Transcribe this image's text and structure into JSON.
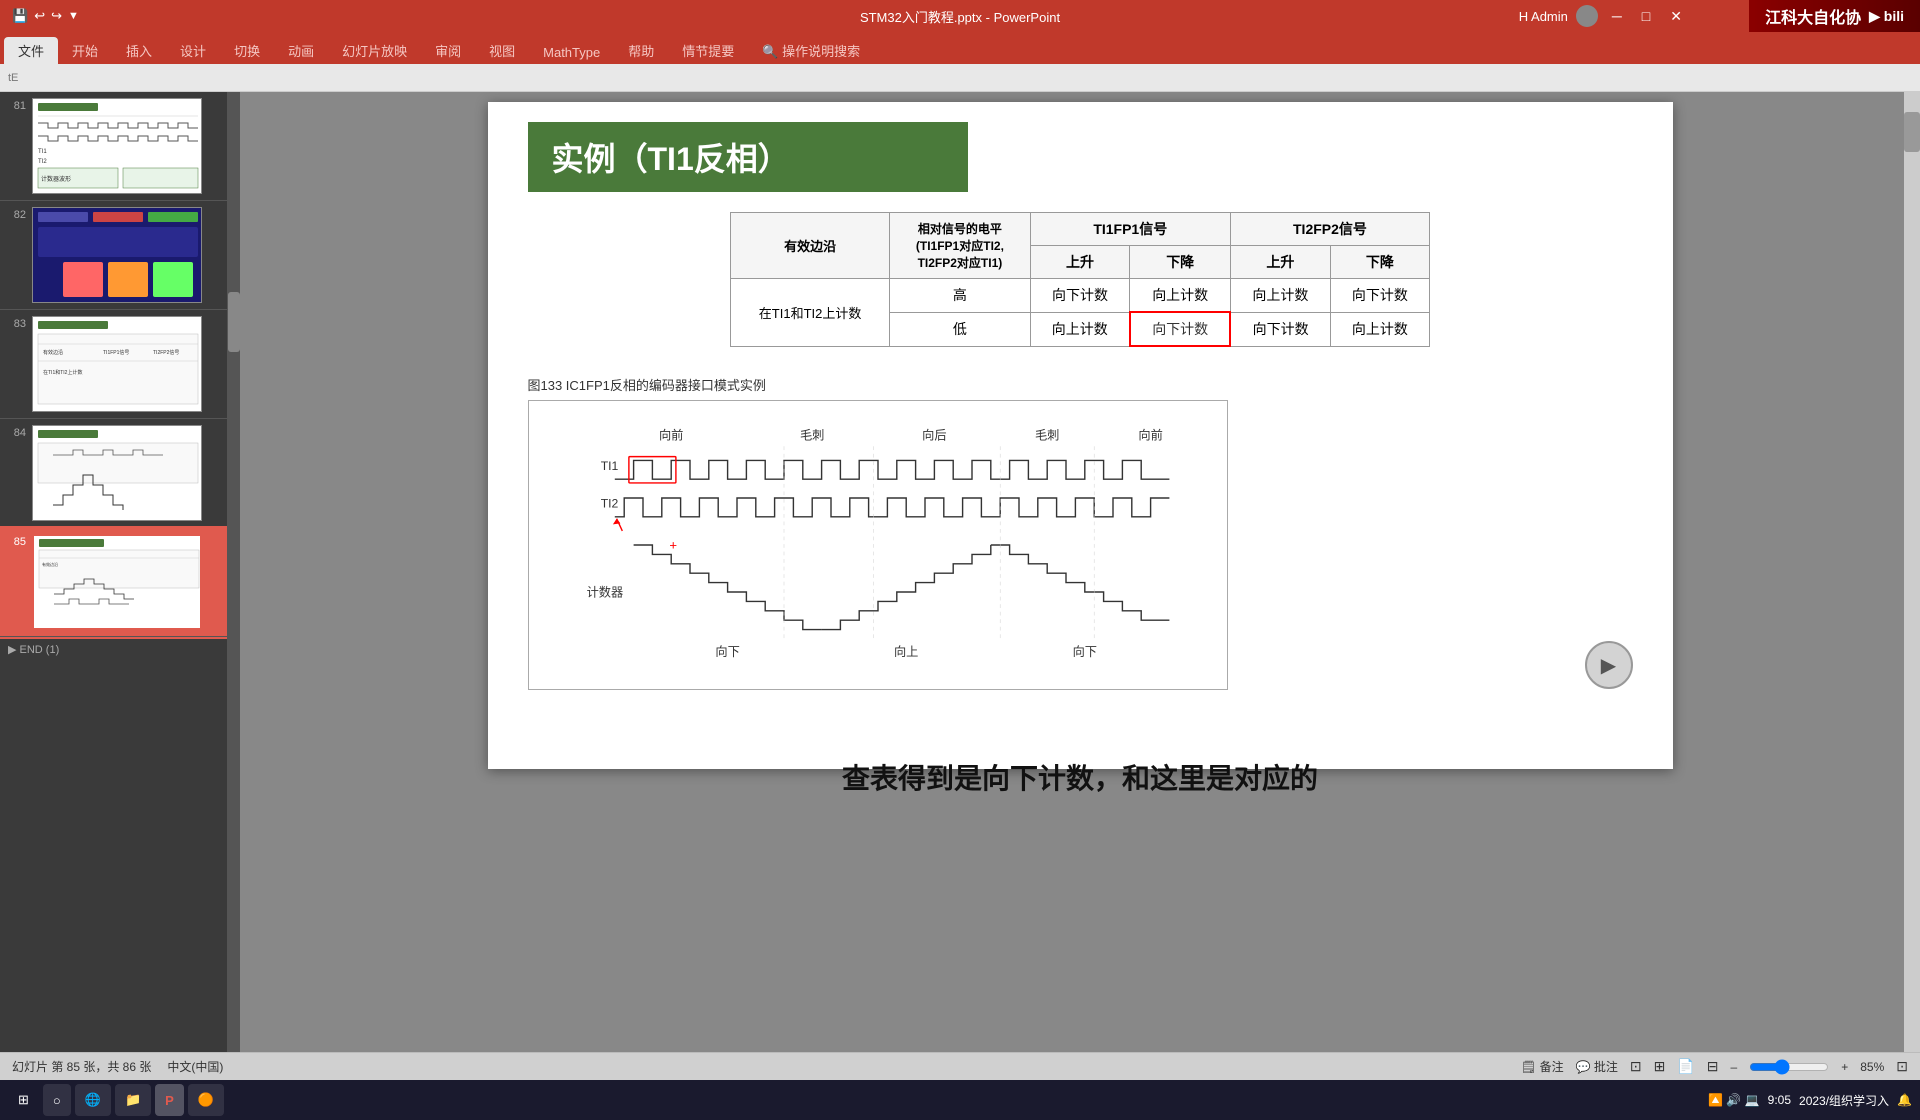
{
  "titlebar": {
    "title": "STM32入门教程.pptx - PowerPoint",
    "user": "H Admin",
    "save_icon": "💾",
    "undo_icon": "↩",
    "redo_icon": "↪"
  },
  "ribbon": {
    "tabs": [
      "文件",
      "开始",
      "插入",
      "设计",
      "切换",
      "动画",
      "幻灯片放映",
      "审阅",
      "视图",
      "MathType",
      "帮助",
      "情节提要",
      "操作说明搜索"
    ]
  },
  "sidebar": {
    "slides": [
      {
        "num": "81",
        "label": "slide-81"
      },
      {
        "num": "82",
        "label": "slide-82"
      },
      {
        "num": "83",
        "label": "slide-83"
      },
      {
        "num": "84",
        "label": "slide-84"
      },
      {
        "num": "85",
        "label": "slide-85",
        "active": true
      }
    ]
  },
  "slide": {
    "title": "实例（TI1反相）",
    "table": {
      "headers": {
        "col1": "有效边沿",
        "col2_header": "相对信号的电平\n(TI1FP1对应TI2,\nTI2FP2对应TI1)",
        "col3_header": "TI1FP1信号",
        "col4_header": "TI2FP2信号",
        "col3_sub1": "上升",
        "col3_sub2": "下降",
        "col4_sub1": "上升",
        "col4_sub2": "下降"
      },
      "rows": [
        {
          "row_header": "在TI1和TI2上计数",
          "level": "高",
          "c1": "向下计数",
          "c2": "向上计数",
          "c3": "向上计数",
          "c4": "向下计数",
          "highlight": ""
        },
        {
          "level": "低",
          "c1": "向上计数",
          "c2": "向下计数",
          "c3": "向下计数",
          "c4": "向上计数",
          "highlight": "c2"
        }
      ]
    },
    "figure_title": "图133    IC1FP1反相的编码器接口模式实例",
    "labels": {
      "ti1": "TI1",
      "ti2": "TI2",
      "counter": "计数器",
      "forward1": "向前",
      "burr1": "毛刺",
      "backward": "向后",
      "burr2": "毛刺",
      "forward2": "向前",
      "down1": "向下",
      "up": "向上",
      "down2": "向下"
    }
  },
  "bottom_text": "查表得到是向下计数，和这里是对应的",
  "statusbar": {
    "slide_info": "幻灯片 第 85 张，共 86 张",
    "language": "中文(中国)",
    "notes": "备注",
    "comments": "批注",
    "zoom": "85%"
  },
  "taskbar": {
    "apps": [
      {
        "label": "⊞",
        "type": "start"
      },
      {
        "label": "○",
        "type": "app"
      },
      {
        "label": "🌐",
        "type": "app"
      },
      {
        "label": "📁",
        "type": "app"
      },
      {
        "label": "P",
        "type": "app",
        "active": true
      },
      {
        "label": "🟠",
        "type": "app"
      }
    ],
    "right": {
      "time": "9:05",
      "date": "2023/组织学习入"
    }
  },
  "brand": "江科大自化协"
}
